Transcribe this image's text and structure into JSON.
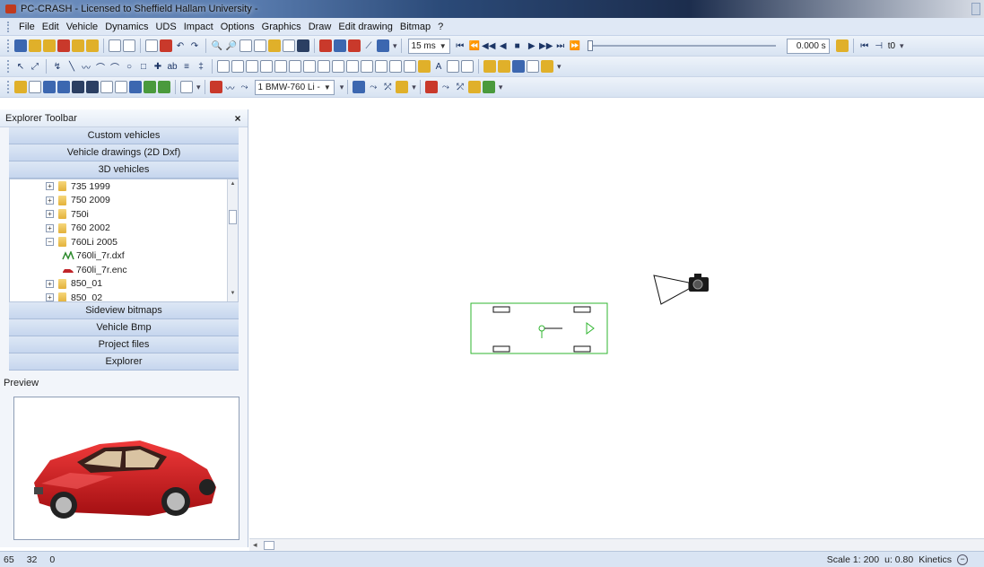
{
  "window": {
    "title": "PC-CRASH - Licensed to Sheffield Hallam University -"
  },
  "menu": [
    "File",
    "Edit",
    "Vehicle",
    "Dynamics",
    "UDS",
    "Impact",
    "Options",
    "Graphics",
    "Draw",
    "Edit drawing",
    "Bitmap",
    "?"
  ],
  "toolbar1": {
    "timestep": "15 ms",
    "time_value": "0.000 s",
    "t0_label": "t0"
  },
  "toolbar3": {
    "vehicle_select": "1 BMW-760 Li -"
  },
  "explorer": {
    "title": "Explorer Toolbar",
    "close_label": "×",
    "sections_top": [
      "Custom vehicles",
      "Vehicle drawings (2D Dxf)",
      "3D vehicles"
    ],
    "tree": [
      {
        "label": "735 1999",
        "type": "folder"
      },
      {
        "label": "750 2009",
        "type": "folder"
      },
      {
        "label": "750i",
        "type": "folder"
      },
      {
        "label": "760 2002",
        "type": "folder"
      },
      {
        "label": "760Li 2005",
        "type": "folder-open"
      },
      {
        "label": "760li_7r.dxf",
        "type": "dxf-file"
      },
      {
        "label": "760li_7r.enc",
        "type": "enc-file"
      },
      {
        "label": "850_01",
        "type": "folder"
      },
      {
        "label": "850_02",
        "type": "folder"
      }
    ],
    "sections_bottom": [
      "Sideview bitmaps",
      "Vehicle Bmp",
      "Project files",
      "Explorer"
    ],
    "preview_label": "Preview"
  },
  "status": {
    "left": [
      "65",
      "32",
      "0"
    ],
    "scale": "Scale 1: 200",
    "mu": "u: 0.80",
    "mode": "Kinetics",
    "zoom_symbol": "−"
  },
  "colors": {
    "vehicle_outline": "#2fb52f",
    "car_body": "#d51b1b",
    "menubar_bg": "#dfe8f5",
    "accordion_bg": "#c6d6ee"
  }
}
